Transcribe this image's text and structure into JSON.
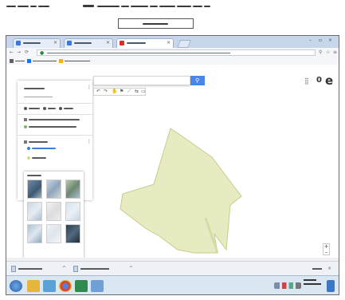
{
  "document": {
    "header_left": "",
    "header_right": "",
    "boxed_label": ""
  },
  "browser": {
    "tabs": [
      {
        "label": "",
        "favicon_color": "#3c78d8",
        "active": false
      },
      {
        "label": "",
        "favicon_color": "#3c78d8",
        "active": false
      },
      {
        "label": "",
        "favicon_color": "#d93025",
        "active": true
      }
    ],
    "url": "",
    "bookmarks": [
      {
        "label": "",
        "icon_color": "#5f6368"
      },
      {
        "label": "",
        "icon_color": "#1a73e8"
      },
      {
        "label": "",
        "icon_color": "#f2b01e"
      }
    ]
  },
  "side_panel": {
    "map_title": "",
    "map_subtitle": "",
    "actions": [
      {
        "label": "",
        "icon": "add-layer-icon"
      },
      {
        "label": "",
        "icon": "share-icon"
      },
      {
        "label": "",
        "icon": "preview-icon"
      }
    ],
    "layer_row": "",
    "layer_style": "",
    "second_layer_title": "",
    "second_layer_link": "",
    "feature": "",
    "basemap_heading": "",
    "basemaps": [
      "satellite",
      "terrain",
      "map",
      "light-political",
      "mono-city",
      "simple-atlas",
      "light-landmass",
      "dark-landmass",
      "whitewater"
    ]
  },
  "search": {
    "placeholder": ""
  },
  "map": {
    "logo": "",
    "polygon_color": "#e8ebc2",
    "polygon_stroke": "#c6cd8a"
  },
  "download_bar": {
    "items": [
      "",
      ""
    ],
    "show_all": ""
  },
  "taskbar": {
    "apps": [
      {
        "name": "start-button",
        "color": "#3a77c9"
      },
      {
        "name": "explorer",
        "color": "#e6b53c"
      },
      {
        "name": "media",
        "color": "#5aa2d6"
      },
      {
        "name": "chrome",
        "color": "#d64a3a"
      },
      {
        "name": "excel",
        "color": "#2f8a4d"
      },
      {
        "name": "paint",
        "color": "#6fa0d8"
      }
    ],
    "time": "",
    "date": ""
  }
}
